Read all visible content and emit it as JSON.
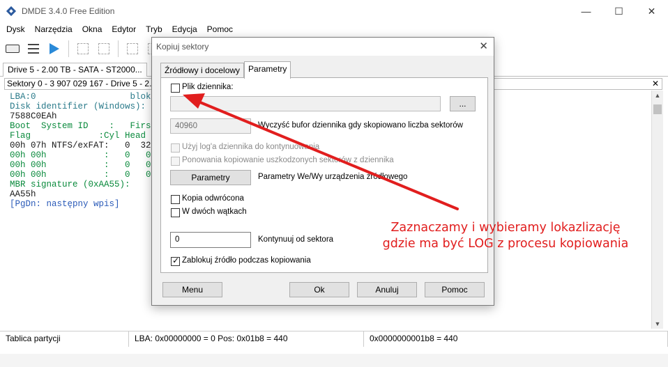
{
  "window": {
    "title": "DMDE 3.4.0 Free Edition",
    "controls": [
      "—",
      "☐",
      "✕"
    ]
  },
  "menu": [
    "Dysk",
    "Narzędzia",
    "Okna",
    "Edytor",
    "Tryb",
    "Edycja",
    "Pomoc"
  ],
  "drive_tab": "Drive 5 - 2.00 TB - SATA - ST2000...",
  "sector_panel_title": "Sektory 0 - 3 907 029 167 - Drive 5 - 2.00",
  "panel_close": "✕",
  "console": {
    "line1a": "LBA:0",
    "line1b": "blok:",
    "line2": "Disk identifier (Windows):",
    "line3": "7588C0EAh",
    "line4": "Boot  System ID    :   First",
    "line5": "Flag             :Cyl Head S",
    "line6": "00h 07h NTFS/exFAT:   0  32 3",
    "line7": "00h 00h           :   0   0  ",
    "line8": "00h 00h           :   0   0  ",
    "line9": "00h 00h           :   0   0  ",
    "line10": "MBR signature (0xAA55):",
    "line11": "AA55h",
    "line12": "[PgDn: następny wpis]"
  },
  "statusbar": {
    "left": "Tablica partycji",
    "mid": "LBA: 0x00000000 = 0  Pos: 0x01b8 = 440",
    "right": "0x0000000001b8 = 440"
  },
  "dialog": {
    "title": "Kopiuj sektory",
    "close": "✕",
    "tabs": [
      "Źródłowy i docelowy",
      "Parametry"
    ],
    "active_tab": "Parametry",
    "log_file_label": "Plik dziennika:",
    "log_file_value": "",
    "browse_label": "...",
    "flush_value": "40960",
    "flush_label": "Wyczyść bufor dziennika gdy skopiowano liczba sektorów",
    "use_log_label": "Użyj log'a dziennika do kontynuowania",
    "retry_label": "Ponowania kopiowanie uszkodzonych sektorów z dziennika",
    "params_button": "Parametry",
    "params_label": "Parametry We/Wy urządzenia źródłowego",
    "reverse_label": "Kopia odwrócona",
    "two_threads_label": "W dwóch wątkach",
    "continue_value": "0",
    "continue_label": "Kontynuuj od sektora",
    "lock_label": "Zablokuj źródło podczas kopiowania",
    "lock_checked": true,
    "buttons": {
      "menu": "Menu",
      "ok": "Ok",
      "cancel": "Anuluj",
      "help": "Pomoc"
    }
  },
  "annotation": {
    "line1": "Zaznaczamy i wybieramy lokazlizację",
    "line2": "gdzie ma być LOG z procesu kopiowania",
    "color": "#e11e1e"
  },
  "colors": {
    "console_green": "#0a8a3c",
    "accent_blue": "#2a8ad8"
  }
}
